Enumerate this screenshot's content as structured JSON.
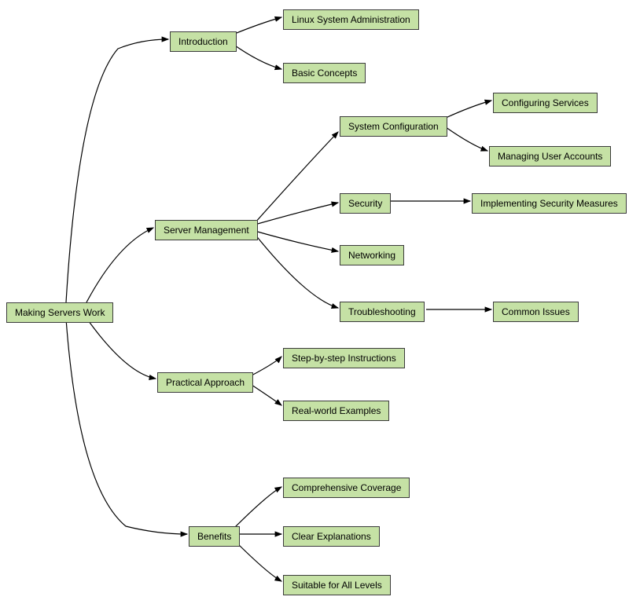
{
  "nodes": {
    "root": "Making Servers Work",
    "introduction": "Introduction",
    "intro_linux": "Linux System Administration",
    "intro_basic": "Basic Concepts",
    "server_mgmt": "Server Management",
    "sysconfig": "System Configuration",
    "sysconfig_services": "Configuring Services",
    "sysconfig_users": "Managing User Accounts",
    "security": "Security",
    "security_impl": "Implementing Security Measures",
    "networking": "Networking",
    "troubleshooting": "Troubleshooting",
    "troubleshooting_common": "Common Issues",
    "practical": "Practical Approach",
    "practical_steps": "Step-by-step Instructions",
    "practical_real": "Real-world Examples",
    "benefits": "Benefits",
    "benefits_comp": "Comprehensive Coverage",
    "benefits_clear": "Clear Explanations",
    "benefits_levels": "Suitable for All Levels"
  },
  "chart_data": {
    "type": "tree",
    "root": "Making Servers Work",
    "children": [
      {
        "label": "Introduction",
        "children": [
          {
            "label": "Linux System Administration"
          },
          {
            "label": "Basic Concepts"
          }
        ]
      },
      {
        "label": "Server Management",
        "children": [
          {
            "label": "System Configuration",
            "children": [
              {
                "label": "Configuring Services"
              },
              {
                "label": "Managing User Accounts"
              }
            ]
          },
          {
            "label": "Security",
            "children": [
              {
                "label": "Implementing Security Measures"
              }
            ]
          },
          {
            "label": "Networking"
          },
          {
            "label": "Troubleshooting",
            "children": [
              {
                "label": "Common Issues"
              }
            ]
          }
        ]
      },
      {
        "label": "Practical Approach",
        "children": [
          {
            "label": "Step-by-step Instructions"
          },
          {
            "label": "Real-world Examples"
          }
        ]
      },
      {
        "label": "Benefits",
        "children": [
          {
            "label": "Comprehensive Coverage"
          },
          {
            "label": "Clear Explanations"
          },
          {
            "label": "Suitable for All Levels"
          }
        ]
      }
    ]
  },
  "colors": {
    "node_fill": "#c5e1a5",
    "node_border": "#3b3b3b",
    "edge": "#000000"
  }
}
